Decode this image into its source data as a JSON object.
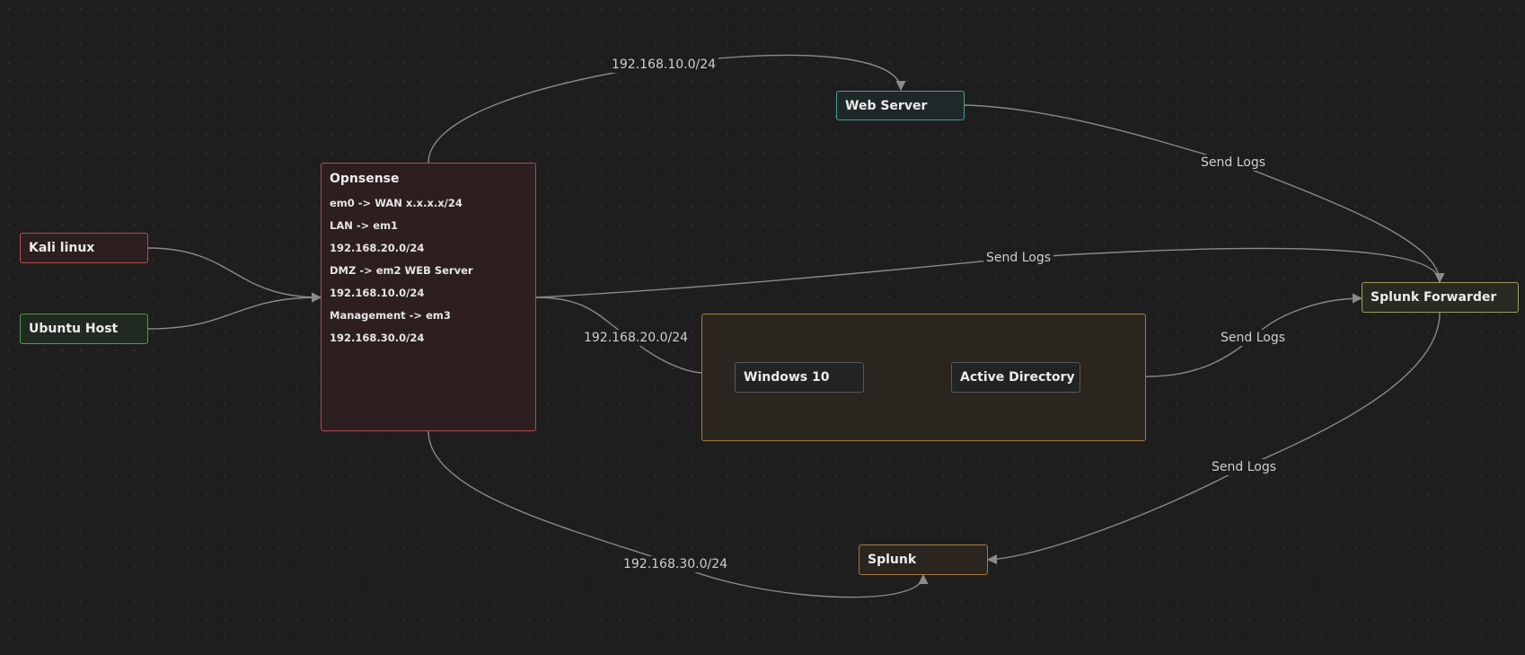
{
  "nodes": {
    "kali": {
      "label": "Kali linux"
    },
    "ubuntu": {
      "label": "Ubuntu Host"
    },
    "opnsense": {
      "label": "Opnsense",
      "lines": [
        "em0 -> WAN x.x.x.x/24",
        "LAN -> em1",
        "192.168.20.0/24",
        "DMZ -> em2 WEB Server",
        "192.168.10.0/24",
        "Management -> em3",
        "192.168.30.0/24"
      ]
    },
    "web_server": {
      "label": "Web Server"
    },
    "lan_group": {
      "children": {
        "windows": "Windows 10",
        "ad": "Active Directory"
      }
    },
    "splunk_forwarder": {
      "label": "Splunk Forwarder"
    },
    "splunk": {
      "label": "Splunk"
    }
  },
  "edges": {
    "opn_web": "192.168.10.0/24",
    "opn_lan": "192.168.20.0/24",
    "opn_splunk": "192.168.30.0/24",
    "web_fwd": "Send Logs",
    "opn_fwd": "Send Logs",
    "lan_fwd": "Send Logs",
    "fwd_splunk": "Send Logs"
  },
  "colors": {
    "background": "#1e1e1e",
    "edge": "#8a8a8a",
    "red": "#b54b4b",
    "green": "#4f9a4f",
    "teal": "#4a9a98",
    "olive": "#9e9e5c",
    "orange": "#a8783f"
  }
}
